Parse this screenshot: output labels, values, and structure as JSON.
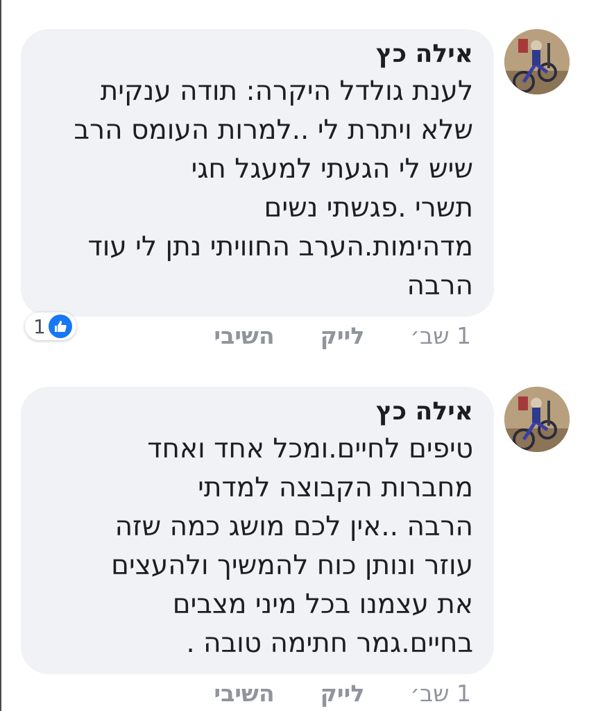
{
  "comments": [
    {
      "author": "אילה כץ",
      "text": "לענת גולדל היקרה: תודה ענקית\nשלא ויתרת לי ..למרות העומס הרב\nשיש לי הגעתי למעגל חגי\nתשרי .פגשתי נשים\nמדהימות.הערב החוויתי נתן לי עוד\nהרבה",
      "time": "1 שב׳",
      "like_label": "לייק",
      "reply_label": "השיבי",
      "reaction_count": "1"
    },
    {
      "author": "אילה כץ",
      "text": "טיפים לחיים.ומכל אחד ואחד\nמחברות הקבוצה למדתי\nהרבה ..אין לכם מושג כמה שזה\nעוזר ונותן כוח להמשיך ולהעצים\nאת עצמנו בכל מיני מצבים\nבחיים.גמר חתימה טובה .",
      "time": "1 שב׳",
      "like_label": "לייק",
      "reply_label": "השיבי"
    }
  ],
  "colors": {
    "bubble": "#f1f2f6",
    "text": "#1c1e21",
    "meta": "#90949c",
    "like_blue": "#1877f2"
  },
  "icons": {
    "reaction": "thumbs-up-icon",
    "avatar": "profile-photo"
  }
}
